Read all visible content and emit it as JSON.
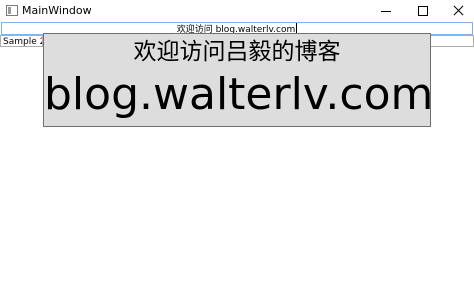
{
  "window": {
    "title": "MainWindow"
  },
  "textbox": {
    "value": "欢迎访问 blog.walterlv.com"
  },
  "sample2": {
    "label": "Sample 2"
  },
  "big_button": {
    "line1": "欢迎访问吕毅的博客",
    "line2": "blog.walterlv.com"
  },
  "icons": {
    "app": "window-app-icon",
    "minimize": "minimize-icon",
    "maximize": "maximize-icon",
    "close": "close-icon"
  }
}
